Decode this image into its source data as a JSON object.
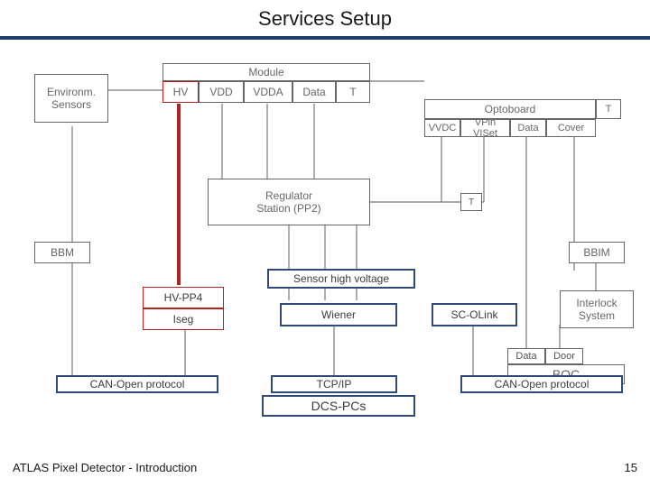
{
  "title": "Services Setup",
  "footer": {
    "left": "ATLAS Pixel Detector - Introduction",
    "right": "15"
  },
  "module": {
    "header": "Module",
    "hv": "HV",
    "vdd": "VDD",
    "vdda": "VDDA",
    "data": "Data",
    "t": "T"
  },
  "environm": "Environm.\nSensors",
  "optoboard": {
    "header": "Optoboard",
    "vvdc": "VVDC",
    "vpin": "VPin VISet",
    "data": "Data",
    "cover": "Cover",
    "t": "T"
  },
  "regulator": "Regulator\nStation (PP2)",
  "bbm": "BBM",
  "bbim": "BBIM",
  "shv": "Sensor high voltage",
  "hvpp4": "HV-PP4",
  "iseg": "Iseg",
  "wiener": "Wiener",
  "scolink": "SC-OLink",
  "interlock": "Interlock\nSystem",
  "boc": {
    "data": "Data",
    "door": "Door",
    "label": "BOC"
  },
  "reg_t": "T",
  "proto": {
    "canopen": "CAN-Open protocol",
    "tcpip": "TCP/IP"
  },
  "dcs": "DCS-PCs"
}
